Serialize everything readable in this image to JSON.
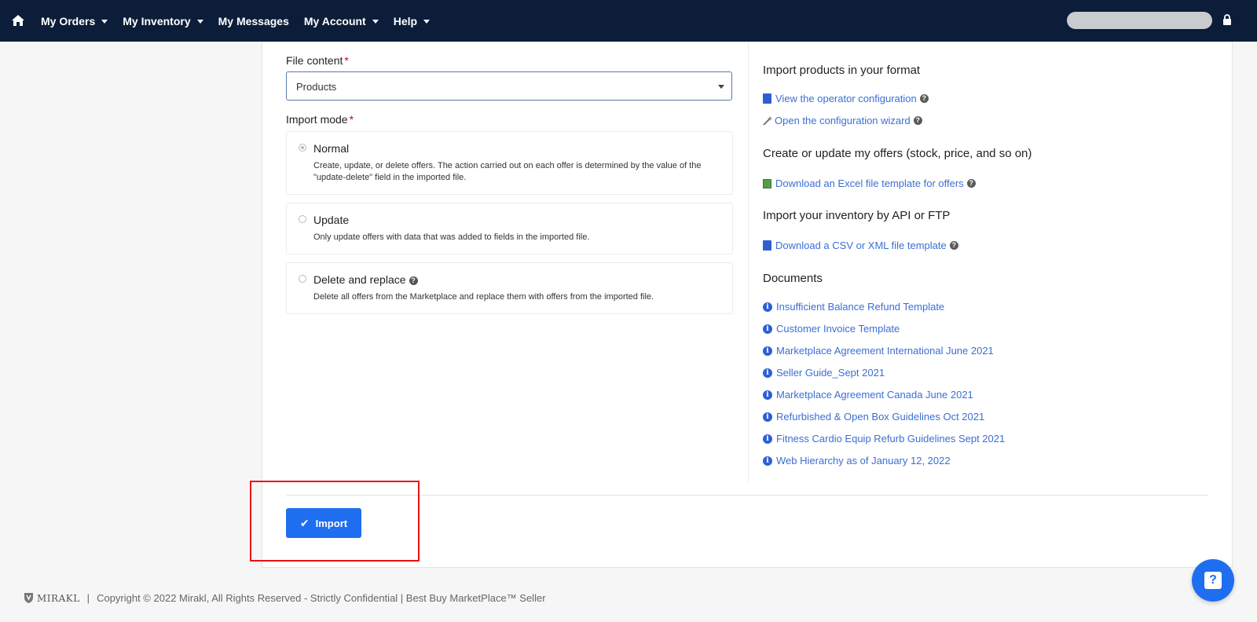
{
  "nav": {
    "items": [
      {
        "label": "My Orders",
        "caret": true
      },
      {
        "label": "My Inventory",
        "caret": true
      },
      {
        "label": "My Messages",
        "caret": false
      },
      {
        "label": "My Account",
        "caret": true
      },
      {
        "label": "Help",
        "caret": true
      }
    ]
  },
  "form": {
    "file_content_label": "File content",
    "required_mark": "*",
    "file_content_value": "Products",
    "import_mode_label": "Import mode",
    "modes": [
      {
        "title": "Normal",
        "desc": "Create, update, or delete offers. The action carried out on each offer is determined by the value of the \"update-delete\" field in the imported file.",
        "selected": true
      },
      {
        "title": "Update",
        "desc": "Only update offers with data that was added to fields in the imported file.",
        "selected": false
      },
      {
        "title": "Delete and replace",
        "desc": "Delete all offers from the Marketplace and replace them with offers from the imported file.",
        "selected": false
      }
    ],
    "import_button": "Import"
  },
  "right": {
    "sec1_title": "Import products in your format",
    "sec1_links": [
      "View the operator configuration",
      "Open the configuration wizard"
    ],
    "sec2_title": "Create or update my offers (stock, price, and so on)",
    "sec2_link": "Download an Excel file template for offers",
    "sec3_title": "Import your inventory by API or FTP",
    "sec3_link": "Download a CSV or XML file template",
    "docs_title": "Documents",
    "docs": [
      "Insufficient Balance Refund Template",
      "Customer Invoice Template",
      "Marketplace Agreement International June 2021",
      "Seller Guide_Sept 2021",
      "Marketplace Agreement Canada June 2021",
      "Refurbished & Open Box Guidelines Oct 2021",
      "Fitness Cardio Equip Refurb Guidelines Sept 2021",
      "Web Hierarchy as of January 12, 2022"
    ]
  },
  "footer": {
    "brand": "MIRAKL",
    "separator": "|",
    "text": "Copyright © 2022 Mirakl, All Rights Reserved - Strictly Confidential | Best Buy MarketPlace™ Seller"
  },
  "icons": {
    "info_glyph": "i",
    "help_glyph": "?",
    "check_glyph": "✔",
    "qmark_glyph": "?"
  },
  "colors": {
    "nav_bg": "#0c1d3a",
    "accent": "#1f6ef0",
    "link": "#3b6fd4",
    "required": "#d0021b",
    "highlight": "#ee1111"
  }
}
